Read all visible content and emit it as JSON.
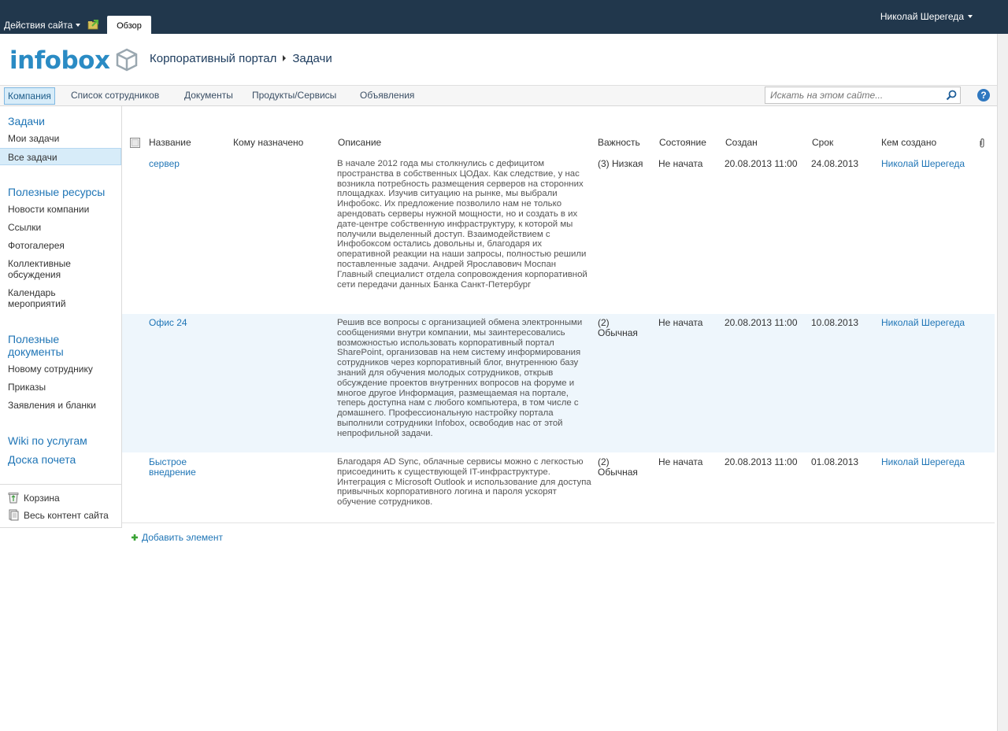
{
  "ribbon": {
    "site_actions": "Действия сайта",
    "browse_tab": "Обзор",
    "user_name": "Николай Шерегеда"
  },
  "header": {
    "logo_text": "infobox",
    "breadcrumb": [
      "Корпоративный портал",
      "Задачи"
    ]
  },
  "topnav": {
    "items": [
      "Компания",
      "Список сотрудников",
      "Документы",
      "Продукты/Сервисы",
      "Объявления"
    ],
    "search_placeholder": "Искать на этом сайте...",
    "help": "?"
  },
  "sidebar": {
    "tasks_heading": "Задачи",
    "tasks_items": [
      "Мои задачи",
      "Все задачи"
    ],
    "resources_heading": "Полезные ресурсы",
    "resources_items": [
      "Новости компании",
      "Ссылки",
      "Фотогалерея",
      "Коллективные обсуждения",
      "Календарь мероприятий"
    ],
    "docs_heading": "Полезные документы",
    "docs_items": [
      "Новому сотруднику",
      "Приказы",
      "Заявления и бланки"
    ],
    "wiki": "Wiki по услугам",
    "honor_board": "Доска почета",
    "recycle_bin": "Корзина",
    "all_content": "Весь контент сайта"
  },
  "table": {
    "columns": [
      "Название",
      "Кому назначено",
      "Описание",
      "Важность",
      "Состояние",
      "Создан",
      "Срок",
      "Кем создано"
    ],
    "rows": [
      {
        "title": "сервер",
        "assigned": "",
        "description": "В начале 2012 года мы столкнулись с дефицитом пространства в собственных ЦОДах. Как следствие, у нас возникла потребность размещения серверов на сторонних площадках. Изучив ситуацию на рынке, мы выбрали Инфобокс. Их предложение позволило нам не только арендовать серверы нужной мощности, но и создать в их дате-центре собственную инфраструктуру, к которой мы получили выделенный доступ. Взаимодействием с Инфобоксом остались довольны и, благодаря их оперативной реакции на наши запросы, полностью решили поставленные задачи. Андрей Ярославович Моспан Главный специалист отдела сопровождения корпоративной сети передачи данных Банка Санкт-Петербург",
        "priority": "(3) Низкая",
        "status": "Не начата",
        "created": "20.08.2013 11:00",
        "due": "24.08.2013",
        "author": "Николай Шерегеда"
      },
      {
        "title": "Офис 24",
        "assigned": "",
        "description": "Решив все вопросы с организацией обмена электронными сообщениями внутри компании, мы заинтересовались возможностью использовать корпоративный портал SharePoint, организовав на нем систему информирования сотрудников через корпоративный блог, внутреннюю базу знаний для обучения молодых сотрудников, открыв обсуждение проектов внутренних вопросов на форуме и многое другое Информация, размещаемая на портале, теперь доступна нам с любого компьютера, в том числе с домашнего. Профессиональную настройку портала выполнили сотрудники Infobox, освободив нас от этой непрофильной задачи.",
        "priority": "(2) Обычная",
        "status": "Не начата",
        "created": "20.08.2013 11:00",
        "due": "10.08.2013",
        "author": "Николай Шерегеда"
      },
      {
        "title": "Быстрое внедрение",
        "assigned": "",
        "description": "Благодаря AD Sync, облачные сервисы можно с легкостью присоединить к существующей IT-инфраструктуре. Интеграция с Microsoft Outlook и использование для доступа привычных корпоративного логина и пароля ускорят обучение сотрудников.",
        "priority": "(2) Обычная",
        "status": "Не начата",
        "created": "20.08.2013 11:00",
        "due": "01.08.2013",
        "author": "Николай Шерегеда"
      }
    ],
    "add_item": "Добавить элемент"
  },
  "colors": {
    "ribbon_bg": "#21374c",
    "link": "#1f75b6",
    "logo": "#2a8bc4",
    "alt_row": "#eef6fc"
  }
}
